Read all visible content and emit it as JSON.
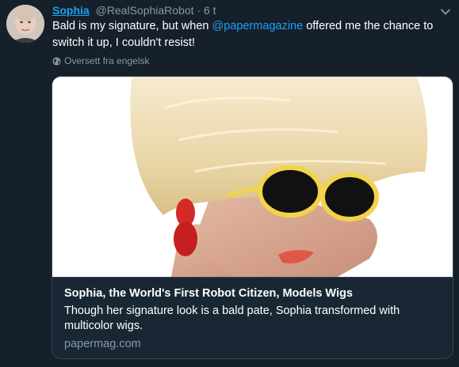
{
  "tweet": {
    "author_name": "Sophia",
    "handle": "@RealSophiaRobot",
    "separator": "·",
    "time": "6 t",
    "text_before": "Bald is my signature, but when ",
    "mention": "@papermagazine",
    "text_after": " offered me the chance to switch it up, I couldn't resist!",
    "translate_label": "Oversett fra engelsk"
  },
  "card": {
    "title": "Sophia, the World's First Robot Citizen, Models Wigs",
    "description": "Though her signature look is a bald pate, Sophia transformed with multicolor wigs.",
    "domain": "papermag.com"
  },
  "colors": {
    "background": "#15202b",
    "accent": "#1da1f2",
    "muted": "#8899a6",
    "border": "#38444d"
  },
  "icons": {
    "caret": "chevron-down-icon",
    "translate": "globe-icon"
  }
}
